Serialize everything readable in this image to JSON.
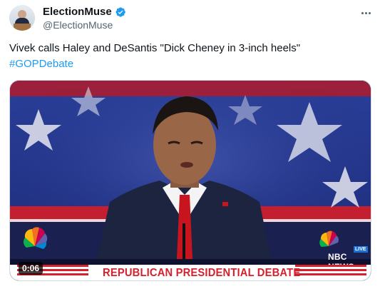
{
  "author": {
    "display_name": "ElectionMuse",
    "handle": "@ElectionMuse",
    "verified": true
  },
  "tweet": {
    "text": "Vivek calls Haley and DeSantis \"Dick Cheney in 3-inch heels\"",
    "hashtag": "#GOPDebate"
  },
  "media": {
    "type": "video",
    "timestamp": "0:06",
    "banner_text": "REPUBLICAN PRESIDENTIAL DEBATE",
    "network_label": "NBC NEWS",
    "live_label": "LIVE"
  },
  "icons": {
    "more": "more-horizontal-icon",
    "verified": "verified-badge-icon"
  },
  "colors": {
    "link": "#1d9bf0",
    "secondary_text": "#536471",
    "verified_blue": "#1d9bf0",
    "banner_red": "#d5202d"
  }
}
